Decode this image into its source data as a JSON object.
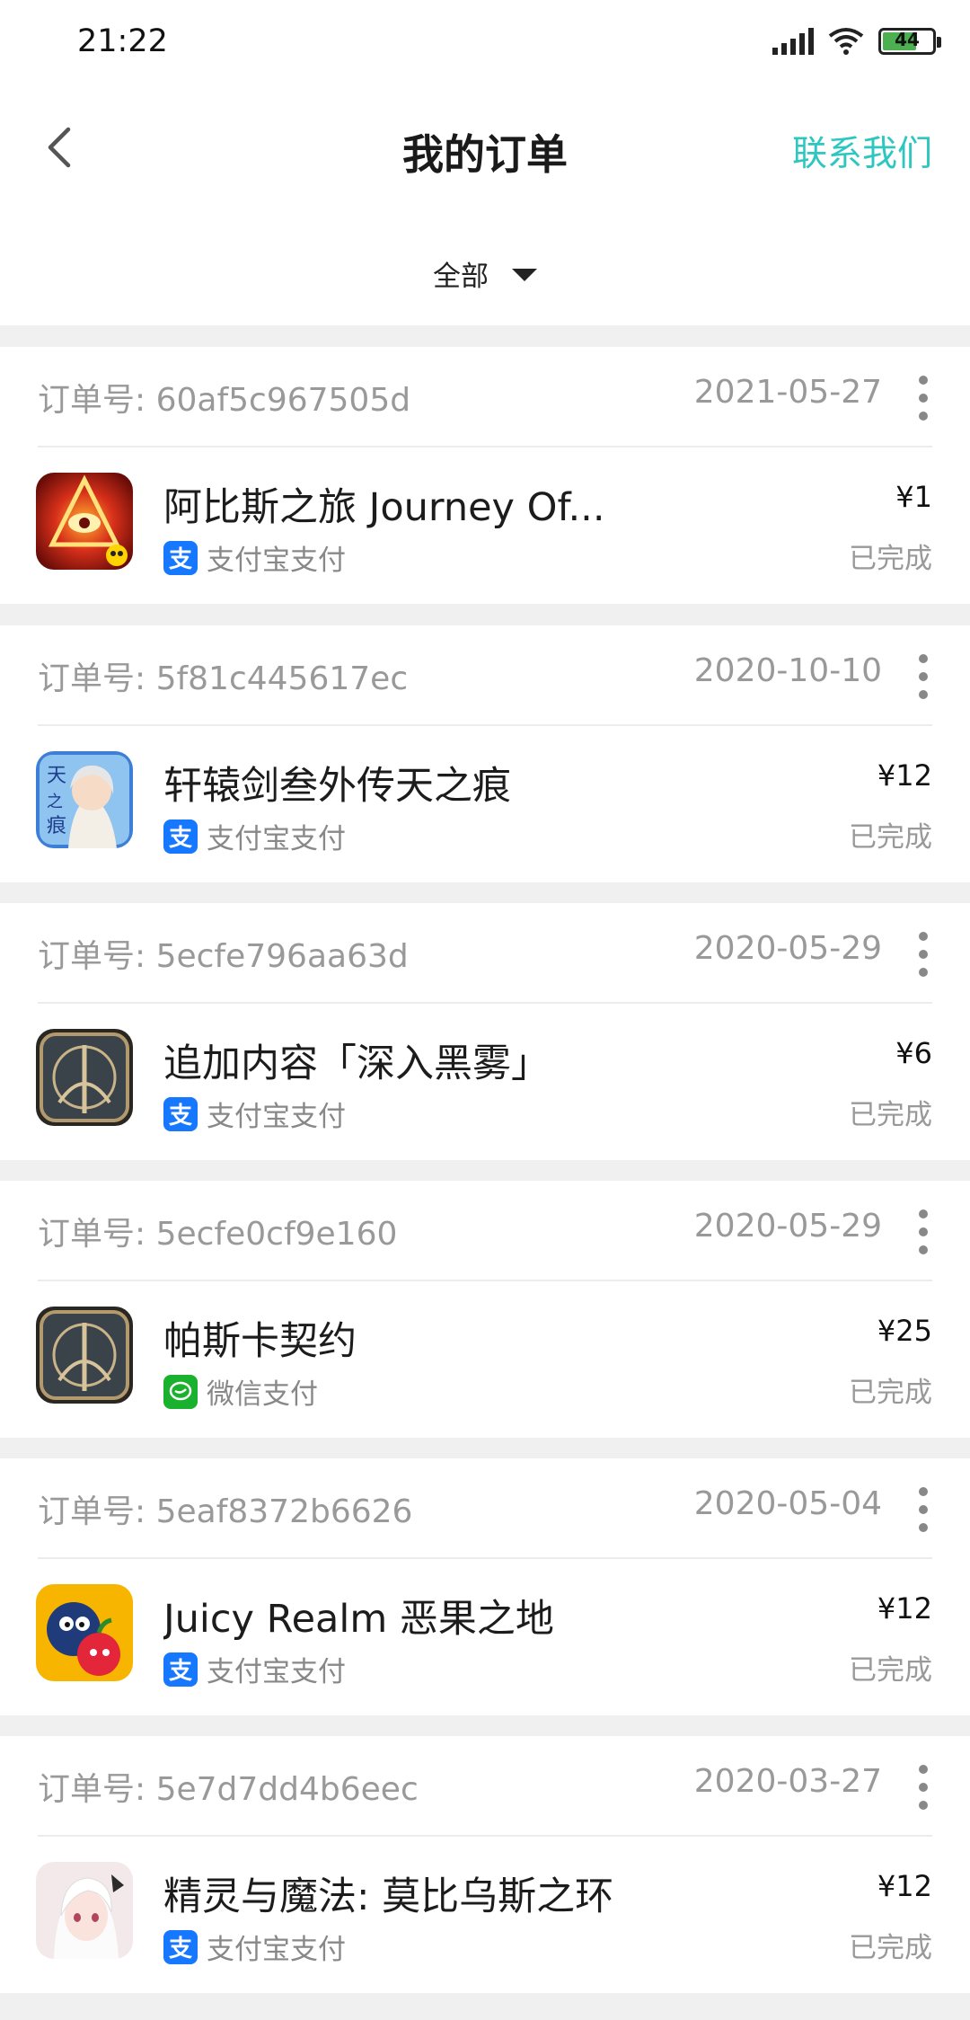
{
  "status_bar": {
    "time": "21:22",
    "battery": "44",
    "icons": [
      "signal-icon",
      "wifi-icon",
      "battery-icon"
    ]
  },
  "header": {
    "title": "我的订单",
    "contact_label": "联系我们",
    "accent_color": "#2ec7c0"
  },
  "filter": {
    "selected": "全部"
  },
  "orders": [
    {
      "order_no": "订单号: 60af5c967505d",
      "date": "2021-05-27",
      "title": "阿比斯之旅 Journey Of...",
      "payment": "支付宝支付",
      "payment_type": "alipay",
      "price": "¥1",
      "status": "已完成",
      "icon": "journey-of-abyss-game-icon"
    },
    {
      "order_no": "订单号: 5f81c445617ec",
      "date": "2020-10-10",
      "title": "轩辕剑叁外传天之痕",
      "payment": "支付宝支付",
      "payment_type": "alipay",
      "price": "¥12",
      "status": "已完成",
      "icon": "xuanyuan-sword-game-icon"
    },
    {
      "order_no": "订单号: 5ecfe796aa63d",
      "date": "2020-05-29",
      "title": "追加内容「深入黑雾」",
      "payment": "支付宝支付",
      "payment_type": "alipay",
      "price": "¥6",
      "status": "已完成",
      "icon": "pascal-contract-dlc-icon"
    },
    {
      "order_no": "订单号: 5ecfe0cf9e160",
      "date": "2020-05-29",
      "title": "帕斯卡契约",
      "payment": "微信支付",
      "payment_type": "wechat",
      "price": "¥25",
      "status": "已完成",
      "icon": "pascal-contract-game-icon"
    },
    {
      "order_no": "订单号: 5eaf8372b6626",
      "date": "2020-05-04",
      "title": "Juicy Realm 恶果之地",
      "payment": "支付宝支付",
      "payment_type": "alipay",
      "price": "¥12",
      "status": "已完成",
      "icon": "juicy-realm-game-icon"
    },
    {
      "order_no": "订单号: 5e7d7dd4b6eec",
      "date": "2020-03-27",
      "title": "精灵与魔法: 莫比乌斯之环",
      "payment": "支付宝支付",
      "payment_type": "alipay",
      "price": "¥12",
      "status": "已完成",
      "icon": "elf-magic-game-icon"
    }
  ]
}
